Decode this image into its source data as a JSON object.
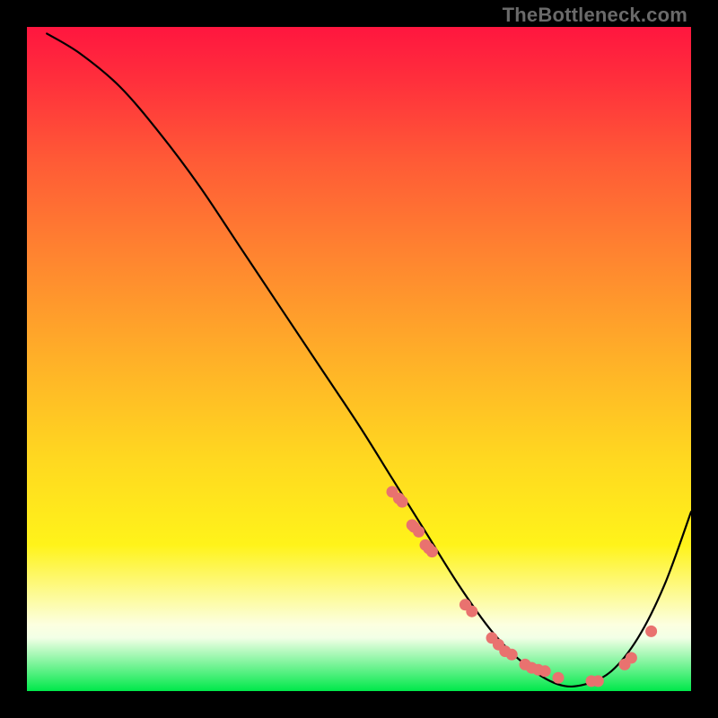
{
  "watermark": "TheBottleneck.com",
  "colors": {
    "point_fill": "#e9726f",
    "curve_stroke": "#000000"
  },
  "chart_data": {
    "type": "line",
    "title": "",
    "xlabel": "",
    "ylabel": "",
    "xlim": [
      0,
      100
    ],
    "ylim": [
      0,
      100
    ],
    "grid": false,
    "annotations": [
      "TheBottleneck.com"
    ],
    "series": [
      {
        "name": "bottleneck-curve",
        "x": [
          3,
          8,
          14,
          20,
          26,
          32,
          38,
          44,
          50,
          55,
          60,
          65,
          70,
          75,
          80,
          84,
          88,
          92,
          96,
          100
        ],
        "y": [
          99,
          96,
          91,
          84,
          76,
          67,
          58,
          49,
          40,
          32,
          24,
          16,
          9,
          4,
          1,
          1,
          3,
          8,
          16,
          27
        ]
      }
    ],
    "highlight_points": {
      "name": "marked-points",
      "x": [
        55,
        56,
        56.5,
        58,
        58.3,
        59,
        60,
        60.5,
        61,
        66,
        67,
        70,
        71,
        72,
        73,
        75,
        76,
        77,
        78,
        80,
        85,
        86,
        90,
        91,
        94
      ],
      "y": [
        30,
        29,
        28.5,
        25,
        24.7,
        24,
        22,
        21.5,
        21,
        13,
        12,
        8,
        7,
        6,
        5.5,
        4,
        3.5,
        3.2,
        3,
        2,
        1.5,
        1.5,
        4,
        5,
        9
      ]
    }
  }
}
